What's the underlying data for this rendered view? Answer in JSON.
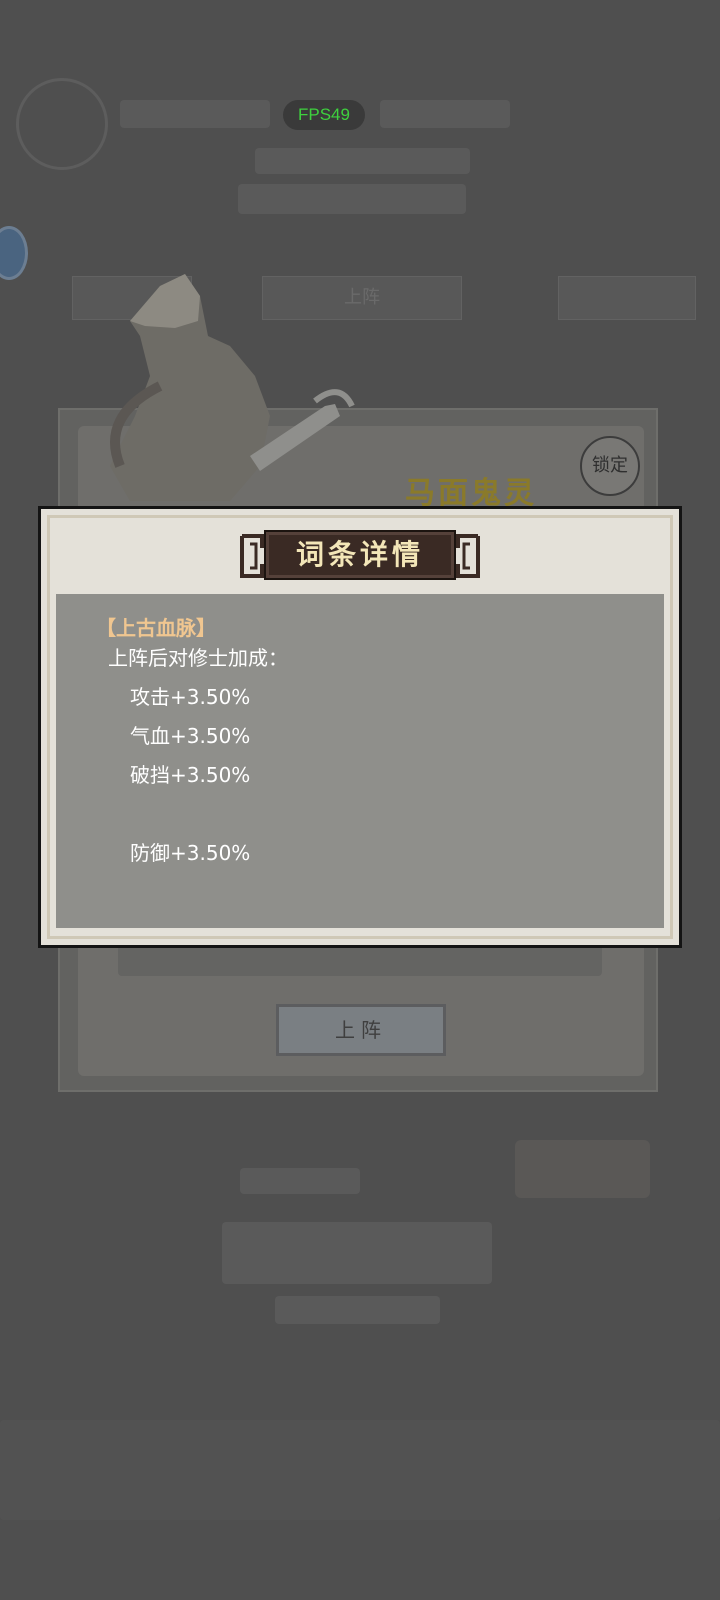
{
  "hud": {
    "fps": "FPS49"
  },
  "background": {
    "pet_name": "马面鬼灵",
    "lock_label": "锁定",
    "deploy_label": "上阵",
    "tab_deploy": "上阵"
  },
  "modal": {
    "title": "词条详情",
    "trait_name": "【上古血脉】",
    "subtitle": "上阵后对修士加成：",
    "effects": [
      "攻击+3.50%",
      "气血+3.50%",
      "破挡+3.50%",
      "防御+3.50%"
    ]
  },
  "colors": {
    "overlay": "#4f4f4f",
    "fps_text": "#3ed13e",
    "trait_name": "#f0c690",
    "title_plate": "#3a2a24",
    "title_text": "#f3e6b8"
  }
}
